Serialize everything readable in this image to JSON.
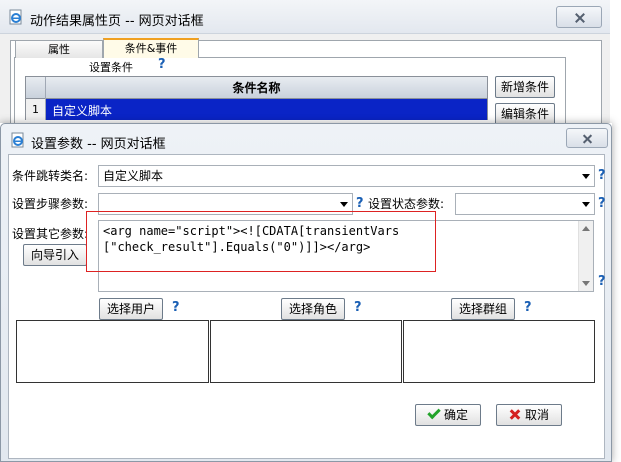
{
  "background_dialog": {
    "title": "动作结果属性页 -- 网页对话框",
    "tabs": [
      "属性",
      "条件&事件"
    ],
    "group_label": "设置条件",
    "help": "?",
    "table": {
      "header": "条件名称",
      "rows": [
        {
          "num": "1",
          "name": "自定义脚本"
        }
      ]
    },
    "buttons": {
      "add": "新增条件",
      "edit": "编辑条件"
    }
  },
  "dialog": {
    "title": "设置参数 -- 网页对话框",
    "jump_label": "条件跳转类名:",
    "jump_value": "自定义脚本",
    "step_label": "设置步骤参数:",
    "step_value": "",
    "state_label": "设置状态参数:",
    "state_value": "",
    "other_label": "设置其它参数:",
    "wizard_button": "向导引入",
    "script_text": "<arg name=\"script\"><![CDATA[transientVars\n[\"check_result\"].Equals(\"0\")]]></arg>",
    "help": "?",
    "select_user": "选择用户",
    "select_role": "选择角色",
    "select_group": "选择群组",
    "ok": "确定",
    "cancel": "取消"
  },
  "colors": {
    "selection": "#0a24c6",
    "highlight_box": "#dd2222",
    "help_mark": "#1a5fb4"
  },
  "icons": [
    "ie-page-icon",
    "close-icon",
    "dropdown-arrow-icon",
    "check-icon",
    "x-icon",
    "help-icon"
  ]
}
